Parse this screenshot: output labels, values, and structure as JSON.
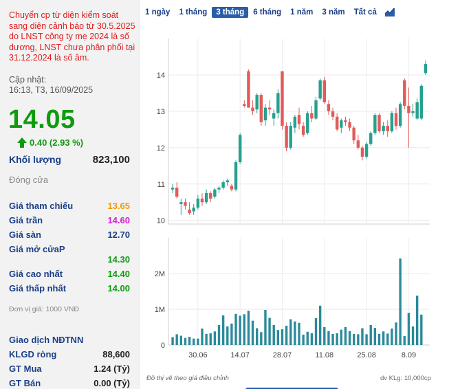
{
  "warning": "Chuyển cp từ diện kiểm soát sang diện cảnh báo từ 30.5.2025 do LNST công ty mẹ 2024 là số dương, LNST chưa phân phối tại 31.12.2024 là số âm.",
  "updated_label": "Cập nhật:",
  "updated_time": "16:13, T3, 16/09/2025",
  "price": "14.05",
  "change": "0.40 (2.93 %)",
  "volume": {
    "label": "Khối lượng",
    "value": "823,100"
  },
  "closed_label": "Đóng cửa",
  "stats": {
    "ref": {
      "label": "Giá tham chiếu",
      "value": "13.65"
    },
    "ceil": {
      "label": "Giá trần",
      "value": "14.60"
    },
    "floor": {
      "label": "Giá sàn",
      "value": "12.70"
    },
    "open": {
      "label": "Giá mở cửaP",
      "value": "14.30"
    },
    "high": {
      "label": "Giá cao nhất",
      "value": "14.40"
    },
    "low": {
      "label": "Giá thấp nhất",
      "value": "14.00"
    }
  },
  "unit_note": "Đơn vị giá: 1000 VNĐ",
  "foreign": {
    "title": "Giao dịch NĐTNN",
    "net": {
      "label": "KLGD ròng",
      "value": "88,600"
    },
    "buy": {
      "label": "GT Mua",
      "value": "1.24 (Tỷ)"
    },
    "sell": {
      "label": "GT Bán",
      "value": "0.00 (Tỷ)"
    }
  },
  "tabs": [
    {
      "label": "1 ngày",
      "active": false
    },
    {
      "label": "1 tháng",
      "active": false
    },
    {
      "label": "3 tháng",
      "active": true
    },
    {
      "label": "6 tháng",
      "active": false
    },
    {
      "label": "1 năm",
      "active": false
    },
    {
      "label": "3 năm",
      "active": false
    },
    {
      "label": "Tất cả",
      "active": false
    }
  ],
  "icons": {
    "up": "up-arrow-icon",
    "chart": "area-chart-icon"
  },
  "colors": {
    "up": "#0e9c0e",
    "down": "#e04545",
    "candle_up": "#27a08f",
    "candle_down": "#e35a5a",
    "volume": "#2a8a9a",
    "accent": "#2b5da8"
  },
  "chart_note_left": "Đồ thị vẽ theo giá điều chỉnh",
  "chart_note_right": "dv KLg: 10,000cp",
  "chart_data": {
    "type": "candlestick",
    "price_axis": {
      "ticks": [
        "10",
        "11",
        "12",
        "13",
        "14"
      ],
      "range": [
        9.9,
        15.0
      ]
    },
    "volume_axis": {
      "ticks": [
        "0",
        "1M",
        "2M"
      ],
      "range": [
        0,
        3000000
      ]
    },
    "x_ticks": [
      "30.06",
      "14.07",
      "28.07",
      "11.08",
      "25.08",
      "8.09"
    ],
    "x_tick_index": [
      6,
      16,
      26,
      36,
      46,
      56
    ],
    "candles": [
      [
        10.85,
        11.0,
        10.75,
        10.9
      ],
      [
        10.9,
        11.05,
        10.6,
        10.65
      ],
      [
        10.45,
        10.6,
        10.15,
        10.5
      ],
      [
        10.5,
        10.6,
        10.3,
        10.4
      ],
      [
        10.3,
        10.5,
        10.15,
        10.2
      ],
      [
        10.25,
        10.45,
        10.15,
        10.35
      ],
      [
        10.35,
        10.7,
        10.3,
        10.6
      ],
      [
        10.6,
        10.75,
        10.4,
        10.5
      ],
      [
        10.5,
        10.85,
        10.45,
        10.75
      ],
      [
        10.75,
        10.8,
        10.5,
        10.6
      ],
      [
        10.65,
        10.9,
        10.6,
        10.85
      ],
      [
        10.85,
        10.95,
        10.75,
        10.9
      ],
      [
        10.9,
        11.1,
        10.85,
        11.05
      ],
      [
        11.05,
        11.15,
        10.95,
        11.1
      ],
      [
        10.95,
        11.0,
        10.8,
        10.85
      ],
      [
        10.85,
        11.65,
        10.8,
        11.6
      ],
      [
        11.6,
        12.4,
        11.55,
        12.35
      ],
      [
        13.2,
        13.3,
        13.1,
        13.15
      ],
      [
        14.1,
        14.15,
        13.1,
        13.1
      ],
      [
        13.1,
        13.3,
        12.9,
        13.0
      ],
      [
        13.05,
        13.5,
        12.95,
        13.45
      ],
      [
        13.45,
        13.5,
        12.6,
        12.7
      ],
      [
        12.75,
        13.2,
        12.6,
        13.1
      ],
      [
        13.1,
        13.3,
        12.9,
        13.05
      ],
      [
        12.8,
        13.05,
        12.6,
        12.95
      ],
      [
        12.95,
        13.6,
        12.8,
        13.5
      ],
      [
        14.1,
        14.1,
        12.5,
        12.6
      ],
      [
        12.6,
        12.7,
        11.9,
        12.0
      ],
      [
        12.0,
        12.7,
        11.95,
        12.6
      ],
      [
        12.55,
        12.9,
        12.4,
        12.85
      ],
      [
        12.9,
        13.1,
        12.5,
        12.65
      ],
      [
        12.6,
        12.7,
        12.3,
        12.35
      ],
      [
        12.4,
        13.0,
        12.35,
        12.95
      ],
      [
        12.95,
        13.15,
        12.7,
        12.8
      ],
      [
        12.8,
        13.4,
        12.75,
        13.3
      ],
      [
        13.35,
        13.9,
        13.3,
        13.85
      ],
      [
        13.85,
        13.95,
        13.2,
        13.25
      ],
      [
        13.2,
        13.3,
        12.9,
        13.0
      ],
      [
        13.0,
        13.1,
        12.75,
        12.85
      ],
      [
        12.85,
        12.95,
        12.45,
        12.5
      ],
      [
        12.55,
        12.8,
        12.4,
        12.75
      ],
      [
        12.75,
        12.85,
        12.6,
        12.7
      ],
      [
        12.7,
        12.8,
        12.45,
        12.55
      ],
      [
        12.55,
        12.6,
        12.1,
        12.2
      ],
      [
        12.2,
        12.35,
        11.95,
        12.0
      ],
      [
        12.0,
        12.05,
        11.65,
        11.75
      ],
      [
        11.75,
        12.15,
        11.7,
        12.1
      ],
      [
        12.1,
        12.45,
        12.05,
        12.4
      ],
      [
        12.4,
        12.95,
        12.35,
        12.9
      ],
      [
        12.9,
        12.95,
        12.4,
        12.45
      ],
      [
        12.45,
        12.7,
        12.35,
        12.6
      ],
      [
        12.6,
        12.75,
        12.3,
        12.45
      ],
      [
        12.45,
        13.0,
        12.4,
        12.95
      ],
      [
        12.95,
        13.1,
        12.5,
        12.6
      ],
      [
        12.6,
        13.25,
        12.55,
        13.2
      ],
      [
        13.85,
        13.9,
        13.05,
        13.15
      ],
      [
        13.15,
        13.65,
        12.0,
        12.95
      ],
      [
        12.95,
        13.2,
        12.85,
        13.0
      ],
      [
        12.8,
        13.35,
        12.75,
        13.25
      ],
      [
        12.8,
        13.75,
        12.75,
        13.7
      ],
      [
        14.05,
        14.4,
        14.0,
        14.3
      ]
    ],
    "volumes": [
      220000,
      300000,
      260000,
      200000,
      230000,
      180000,
      180000,
      460000,
      310000,
      330000,
      380000,
      560000,
      830000,
      520000,
      600000,
      870000,
      820000,
      860000,
      960000,
      680000,
      470000,
      360000,
      980000,
      760000,
      560000,
      420000,
      440000,
      540000,
      720000,
      660000,
      620000,
      290000,
      370000,
      330000,
      750000,
      1100000,
      500000,
      390000,
      310000,
      330000,
      430000,
      500000,
      390000,
      310000,
      300000,
      470000,
      300000,
      560000,
      480000,
      310000,
      380000,
      320000,
      460000,
      630000,
      2420000,
      250000,
      900000,
      520000,
      1380000,
      850000
    ]
  }
}
